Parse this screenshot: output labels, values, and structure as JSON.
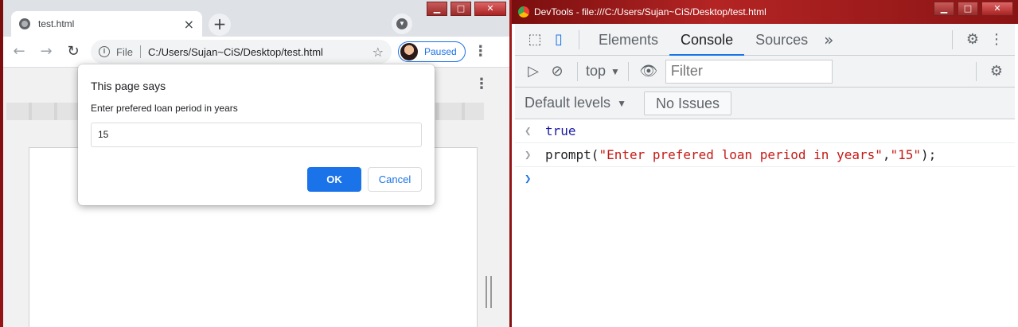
{
  "chrome": {
    "tab_title": "test.html",
    "omnibox": {
      "scheme": "File",
      "url": "C:/Users/Sujan~CiS/Desktop/test.html"
    },
    "profile_status": "Paused",
    "dialog": {
      "title": "This page says",
      "message": "Enter prefered loan period in years",
      "input_value": "15",
      "ok_label": "OK",
      "cancel_label": "Cancel"
    }
  },
  "devtools": {
    "window_title": "DevTools - file:///C:/Users/Sujan~CiS/Desktop/test.html",
    "tabs": [
      "Elements",
      "Console",
      "Sources"
    ],
    "active_tab": "Console",
    "context": "top",
    "filter_placeholder": "Filter",
    "levels_label": "Default levels",
    "issues_label": "No Issues",
    "console": {
      "result_value": "true",
      "command_fn": "prompt(",
      "command_arg1": "\"Enter prefered loan period in years\"",
      "command_comma": ",",
      "command_arg2": "\"15\"",
      "command_end": ");"
    }
  },
  "colors": {
    "accent": "#1a73e8",
    "string": "#c41a16",
    "keyword_value": "#1a1aa6"
  }
}
